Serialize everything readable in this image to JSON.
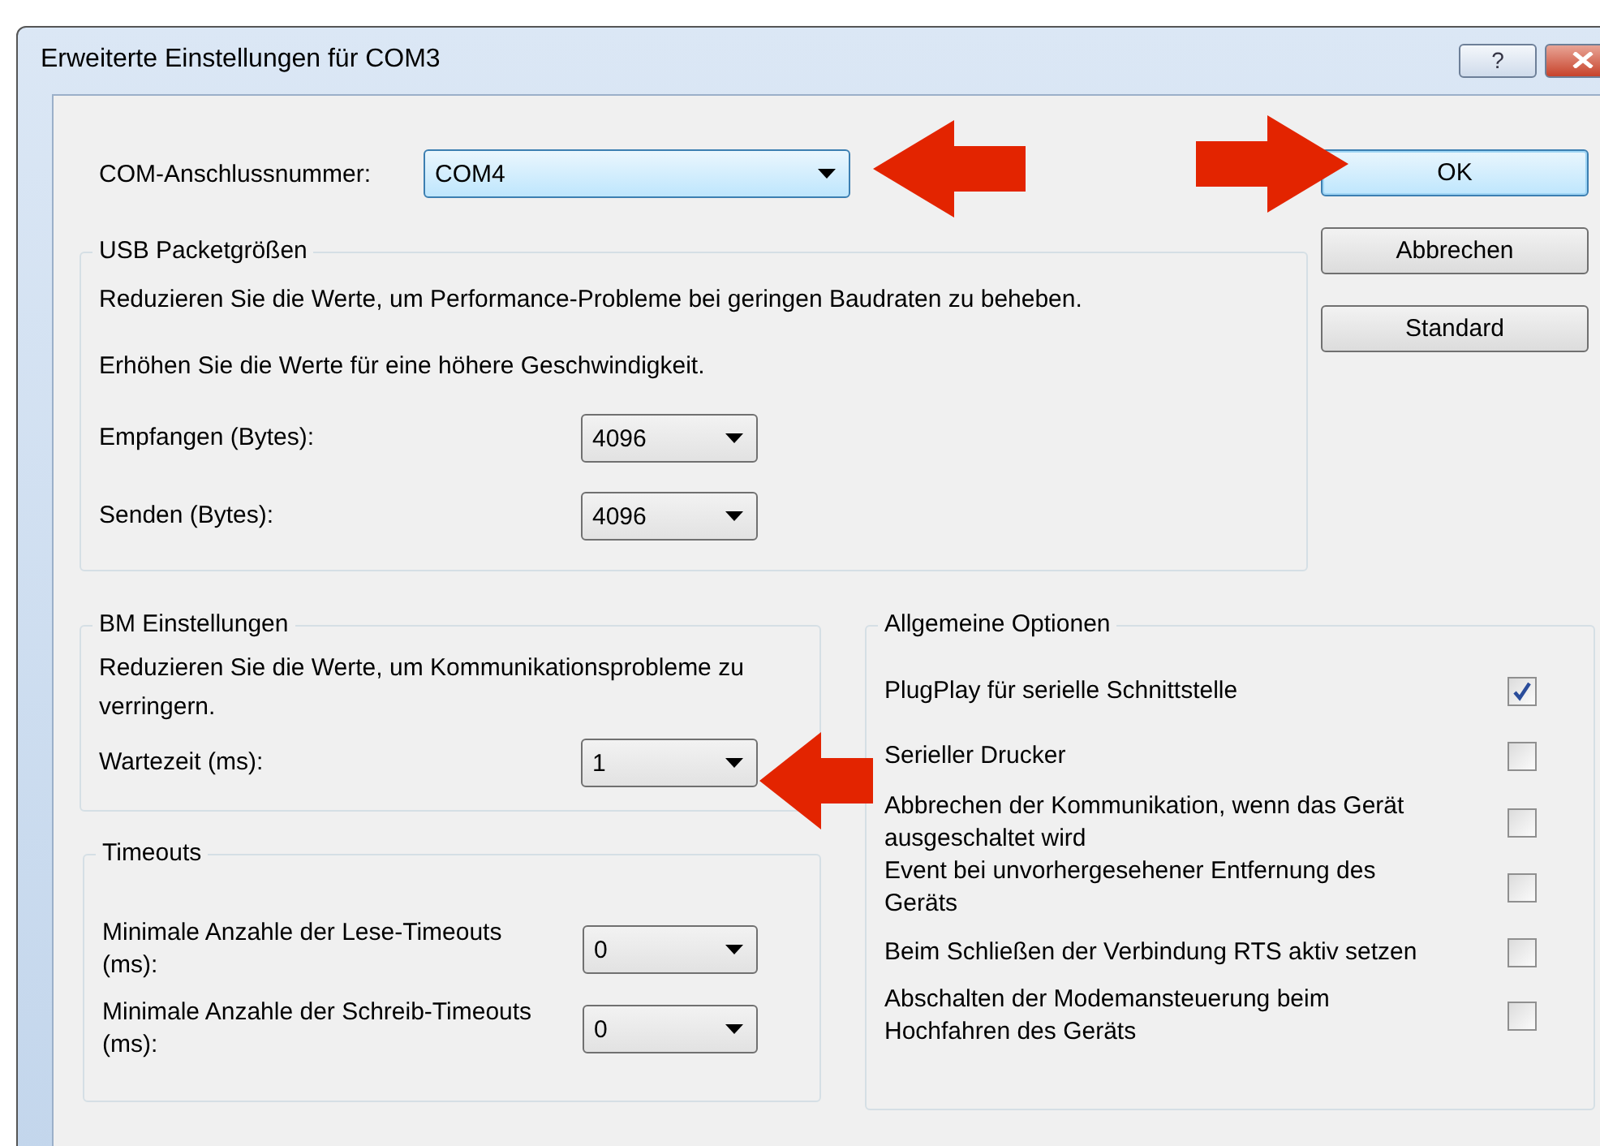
{
  "window": {
    "title": "Erweiterte Einstellungen für COM3",
    "help_button": "?"
  },
  "port": {
    "label": "COM-Anschlussnummer:",
    "value": "COM4"
  },
  "buttons": [
    {
      "label": "OK",
      "default": true
    },
    {
      "label": "Abbrechen",
      "default": false
    },
    {
      "label": "Standard",
      "default": false
    }
  ],
  "usb_group": {
    "title": "USB Packetgrößen",
    "notes": [
      "Reduzieren Sie die Werte, um Performance-Probleme bei geringen Baudraten zu beheben.",
      "Erhöhen Sie die Werte für eine höhere Geschwindigkeit."
    ],
    "fields": [
      {
        "label": "Empfangen (Bytes):",
        "value": "4096"
      },
      {
        "label": "Senden (Bytes):",
        "value": "4096"
      }
    ]
  },
  "bm_group": {
    "title": "BM Einstellungen",
    "note": "Reduzieren Sie die Werte, um Kommunikationsprobleme zu verringern.",
    "fields": [
      {
        "label": "Wartezeit (ms):",
        "value": "1"
      }
    ]
  },
  "timeouts": {
    "title": "Timeouts",
    "fields": [
      {
        "label": "Minimale Anzahle der Lese-Timeouts (ms):",
        "value": "0"
      },
      {
        "label": "Minimale Anzahle der Schreib-Timeouts (ms):",
        "value": "0"
      }
    ]
  },
  "general_options": {
    "title": "Allgemeine Optionen",
    "options": [
      {
        "label": "PlugPlay für serielle Schnittstelle",
        "checked": true
      },
      {
        "label": "Serieller Drucker",
        "checked": false
      },
      {
        "label": "Abbrechen der Kommunikation, wenn das Gerät ausgeschaltet wird",
        "checked": false
      },
      {
        "label": "Event bei unvorhergesehener Entfernung des Geräts",
        "checked": false
      },
      {
        "label": "Beim Schließen der Verbindung RTS aktiv setzen",
        "checked": false
      },
      {
        "label": "Abschalten der Modemansteuerung beim Hochfahren des Geräts",
        "checked": false
      }
    ]
  }
}
